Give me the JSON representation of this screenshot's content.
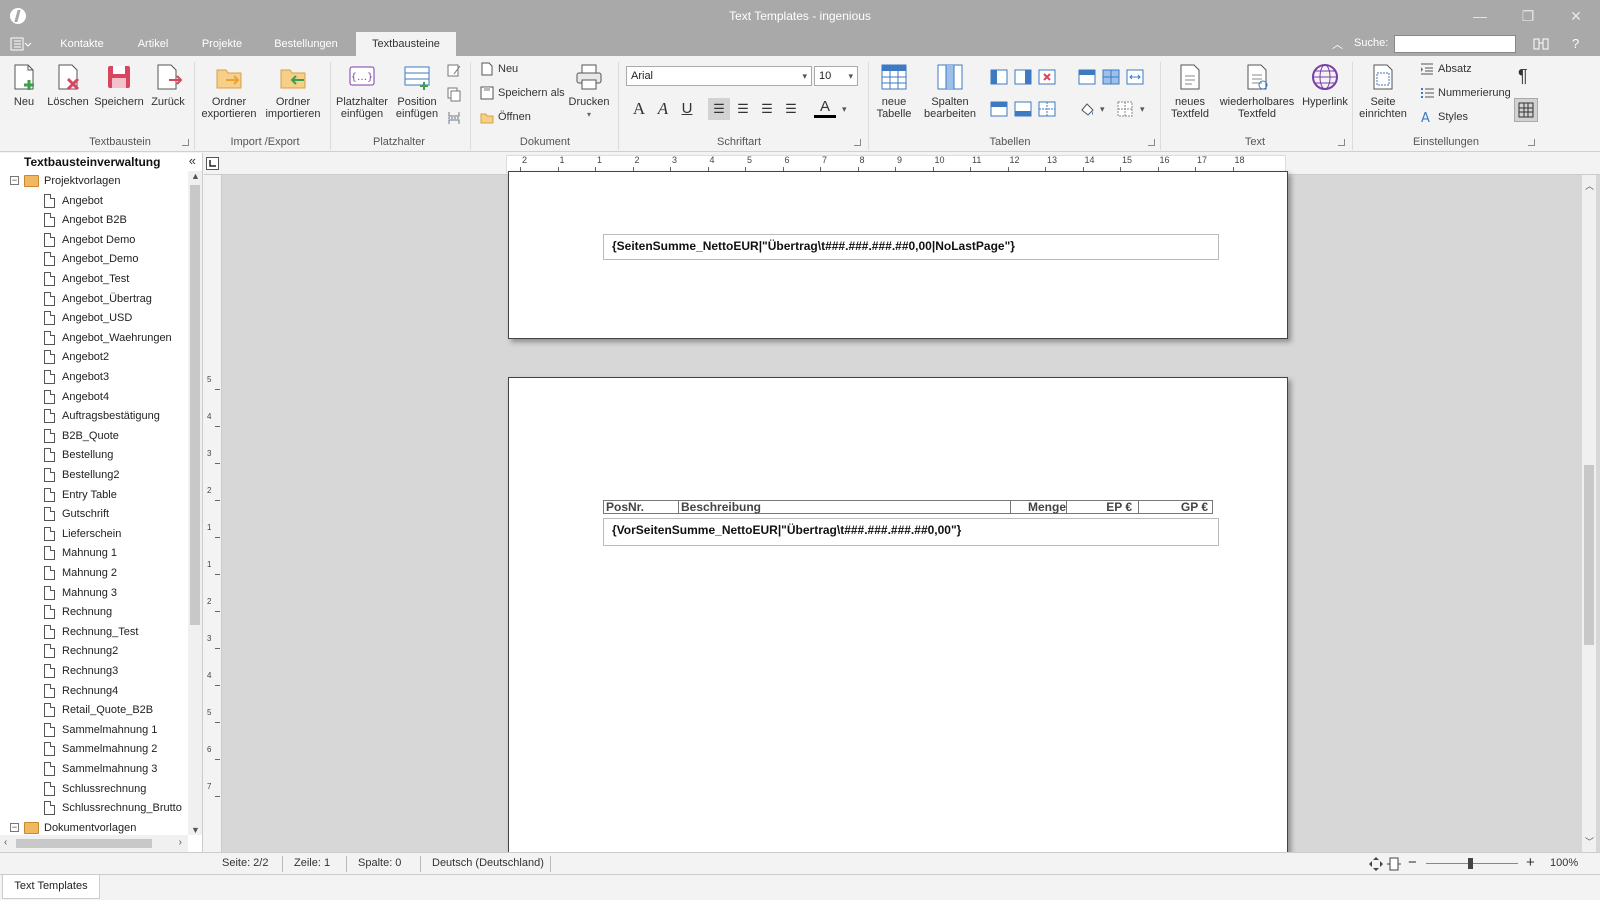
{
  "window": {
    "title": "Text Templates - ingenious",
    "minimize_glyph": "—",
    "restore_glyph": "❐",
    "close_glyph": "✕"
  },
  "tabs": [
    {
      "label": "Kontakte"
    },
    {
      "label": "Artikel"
    },
    {
      "label": "Projekte"
    },
    {
      "label": "Bestellungen"
    },
    {
      "label": "Textbausteine",
      "active": true
    }
  ],
  "search": {
    "label": "Suche:",
    "value": ""
  },
  "ribbon": {
    "groups": {
      "textbaustein": "Textbaustein",
      "import_export": "Import /Export",
      "platzhalter": "Platzhalter",
      "dokument": "Dokument",
      "schriftart": "Schriftart",
      "tabellen": "Tabellen",
      "text": "Text",
      "einstellungen": "Einstellungen"
    },
    "buttons": {
      "neu": "Neu",
      "loeschen": "Löschen",
      "speichern": "Speichern",
      "zurueck": "Zurück",
      "ordner_export_1": "Ordner",
      "ordner_export_2": "exportieren",
      "ordner_import_1": "Ordner",
      "ordner_import_2": "importieren",
      "platzhalter_1": "Platzhalter",
      "platzhalter_2": "einfügen",
      "position_1": "Position",
      "position_2": "einfügen",
      "doc_neu": "Neu",
      "doc_speichern_als": "Speichern als",
      "doc_oeffnen": "Öffnen",
      "drucken": "Drucken",
      "neue_tabelle_1": "neue",
      "neue_tabelle_2": "Tabelle",
      "spalten_1": "Spalten",
      "spalten_2": "bearbeiten",
      "neues_textfeld_1": "neues",
      "neues_textfeld_2": "Textfeld",
      "wiederholbares_1": "wiederholbares",
      "wiederholbares_2": "Textfeld",
      "hyperlink": "Hyperlink",
      "seite_1": "Seite",
      "seite_2": "einrichten",
      "absatz": "Absatz",
      "nummerierung": "Nummerierung",
      "styles": "Styles"
    },
    "font": {
      "name": "Arial",
      "size": "10"
    }
  },
  "sidebar": {
    "title": "Textbausteinverwaltung",
    "folders": [
      {
        "label": "Projektvorlagen",
        "items": [
          "Angebot",
          "Angebot B2B",
          "Angebot Demo",
          "Angebot_Demo",
          "Angebot_Test",
          "Angebot_Übertrag",
          "Angebot_USD",
          "Angebot_Waehrungen",
          "Angebot2",
          "Angebot3",
          "Angebot4",
          "Auftragsbestätigung",
          "B2B_Quote",
          "Bestellung",
          "Bestellung2",
          "Entry Table",
          "Gutschrift",
          "Lieferschein",
          "Mahnung 1",
          "Mahnung 2",
          "Mahnung 3",
          "Rechnung",
          "Rechnung_Test",
          "Rechnung2",
          "Rechnung3",
          "Rechnung4",
          "Retail_Quote_B2B",
          "Sammelmahnung 1",
          "Sammelmahnung 2",
          "Sammelmahnung 3",
          "Schlussrechnung",
          "Schlussrechnung_Brutto"
        ]
      },
      {
        "label": "Dokumentvorlagen",
        "items": []
      }
    ]
  },
  "ruler": {
    "h_ticks": [
      "2",
      "1",
      "1",
      "2",
      "3",
      "4",
      "5",
      "6",
      "7",
      "8",
      "9",
      "10",
      "11",
      "12",
      "13",
      "14",
      "15",
      "16",
      "17",
      "18"
    ],
    "v_ticks": [
      "5",
      "4",
      "3",
      "2",
      "1",
      "1",
      "2",
      "3",
      "4",
      "5",
      "6",
      "7"
    ]
  },
  "document": {
    "page1_field": "{SeitenSumme_NettoEUR|\"Übertrag\\t###.###.###.##0,00|NoLastPage\"}",
    "table_header": {
      "posnr": "PosNr.",
      "beschreibung": "Beschreibung",
      "menge": "Menge",
      "ep": "EP €",
      "gp": "GP €"
    },
    "page2_field": "{VorSeitenSumme_NettoEUR|\"Übertrag\\t###.###.###.##0,00\"}"
  },
  "status": {
    "seite": "Seite: 2/2",
    "zeile": "Zeile: 1",
    "spalte": "Spalte: 0",
    "sprache": "Deutsch (Deutschland)",
    "zoom": "100%"
  },
  "bottom_tab": "Text Templates",
  "colors": {
    "titlebar": "#a9a9a9",
    "accent_red": "#d9455f",
    "accent_orange": "#f0a030",
    "accent_blue": "#3d7ac2",
    "accent_purple": "#7a3ea8",
    "accent_green": "#3aa04a"
  }
}
